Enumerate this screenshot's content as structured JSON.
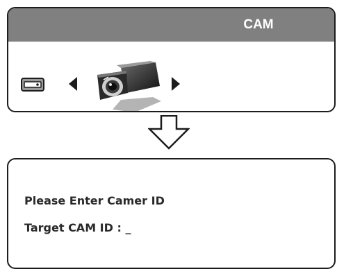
{
  "camera_panel": {
    "title": "CAM",
    "input_icon": "input-source-icon",
    "prev_icon": "arrow-left-icon",
    "camera_icon": "security-camera-icon",
    "next_icon": "arrow-right-icon"
  },
  "transition_icon": "down-arrow-icon",
  "id_panel": {
    "prompt": "Please Enter Camer ID",
    "target_label": "Target CAM ID : _"
  },
  "colors": {
    "title_bar": "#808080",
    "title_text": "#ffffff",
    "border": "#1c1c1c",
    "text": "#2a2a2a"
  }
}
